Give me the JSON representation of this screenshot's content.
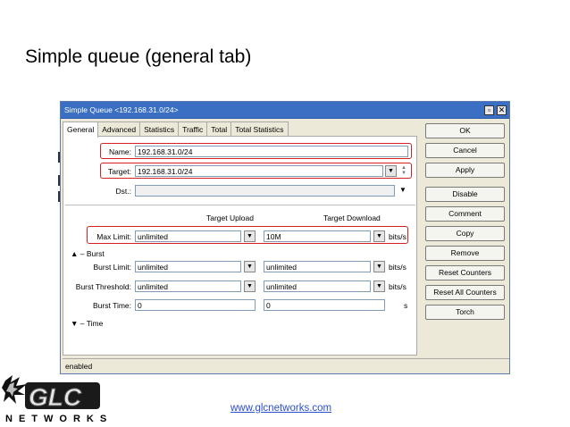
{
  "slide": {
    "title": "Simple queue (general tab)",
    "url": "www.glcnetworks.com",
    "logo_text": "NETWORKS"
  },
  "window": {
    "title": "Simple Queue <192.168.31.0/24>",
    "tabs": [
      "General",
      "Advanced",
      "Statistics",
      "Traffic",
      "Total",
      "Total Statistics"
    ],
    "active_tab": "General",
    "status": "enabled"
  },
  "form": {
    "name": {
      "label": "Name:",
      "value": "192.168.31.0/24"
    },
    "target": {
      "label": "Target:",
      "value": "192.168.31.0/24"
    },
    "dst": {
      "label": "Dst.:",
      "value": ""
    },
    "upload_header": "Target Upload",
    "download_header": "Target Download",
    "max_limit": {
      "label": "Max Limit:",
      "upload": "unlimited",
      "download": "10M",
      "unit": "bits/s"
    },
    "burst_section": "Burst",
    "burst_limit": {
      "label": "Burst Limit:",
      "upload": "unlimited",
      "download": "unlimited",
      "unit": "bits/s"
    },
    "burst_threshold": {
      "label": "Burst Threshold:",
      "upload": "unlimited",
      "download": "unlimited",
      "unit": "bits/s"
    },
    "burst_time": {
      "label": "Burst Time:",
      "upload": "0",
      "download": "0",
      "unit": "s"
    },
    "time_section": "Time"
  },
  "buttons": {
    "ok": "OK",
    "cancel": "Cancel",
    "apply": "Apply",
    "disable": "Disable",
    "comment": "Comment",
    "copy": "Copy",
    "remove": "Remove",
    "reset_counters": "Reset Counters",
    "reset_all_counters": "Reset All Counters",
    "torch": "Torch"
  },
  "colors": {
    "titlebar": "#3a6fc4",
    "highlight": "#d42020",
    "url": "#2c4fd1"
  }
}
